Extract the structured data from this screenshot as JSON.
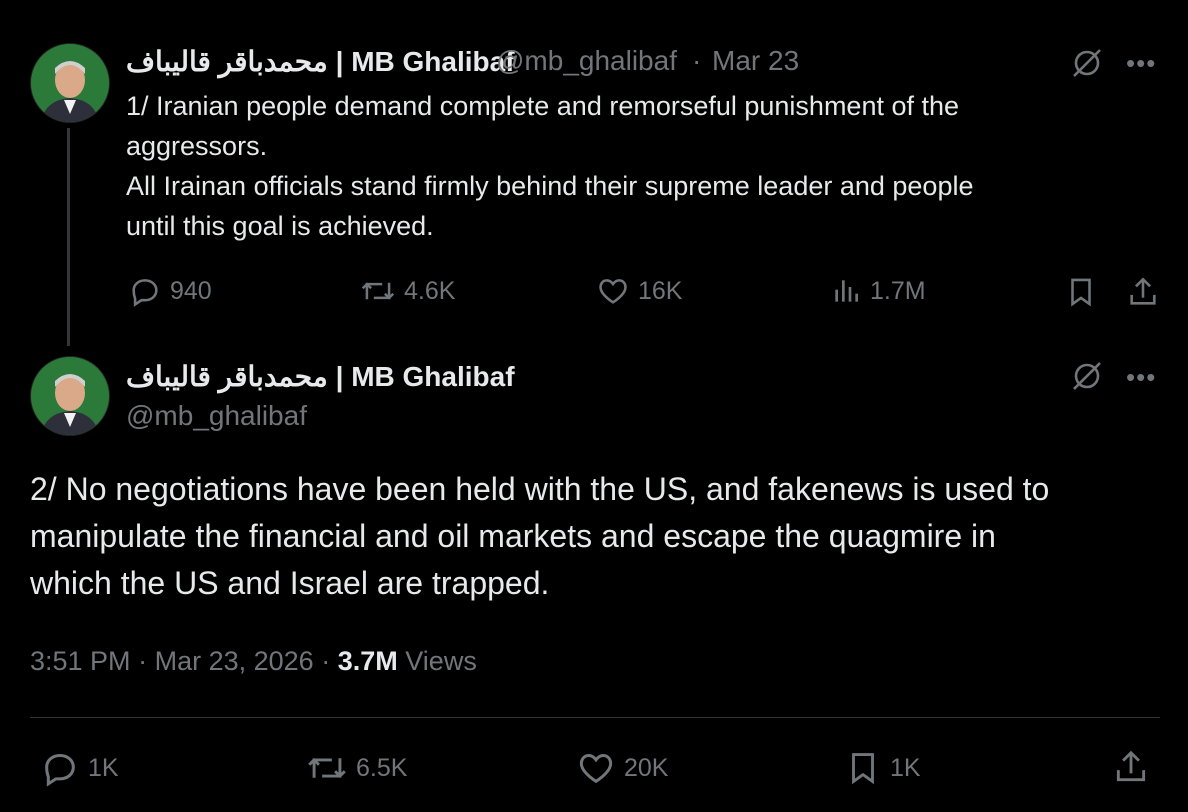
{
  "tweet1": {
    "display_name": "محمدباقر قالیباف | MB Ghalibaf",
    "handle": "@mb_ghalibaf",
    "separator": "·",
    "date": "Mar 23",
    "text_line1": "1/ Iranian people demand complete and remorseful punishment of the",
    "text_line2": "aggressors.",
    "text_line3": "All Irainan officials stand firmly behind their supreme leader and people",
    "text_line4": "until this goal is achieved.",
    "replies": "940",
    "reposts": "4.6K",
    "likes": "16K",
    "views": "1.7M"
  },
  "tweet2": {
    "display_name": "محمدباقر قالیباف | MB Ghalibaf",
    "handle": "@mb_ghalibaf",
    "text_line1": "2/ No negotiations have been held with the US, and fakenews is used to",
    "text_line2": "manipulate the financial and oil markets and escape the quagmire in",
    "text_line3": "which the US and Israel are trapped.",
    "time": "3:51 PM",
    "separator": "·",
    "full_date": "Mar 23, 2026",
    "views_count": "3.7M",
    "views_label": "Views",
    "replies": "1K",
    "reposts": "6.5K",
    "likes": "20K",
    "bookmarks": "1K"
  },
  "icons": {
    "more": "more-icon",
    "grok": "grok-icon",
    "reply": "reply-icon",
    "repost": "repost-icon",
    "like": "like-icon",
    "views": "views-icon",
    "bookmark": "bookmark-icon",
    "share": "share-icon"
  },
  "colors": {
    "background": "#000000",
    "text": "#e7e9ea",
    "muted": "#71767b",
    "divider": "#2f3336"
  }
}
